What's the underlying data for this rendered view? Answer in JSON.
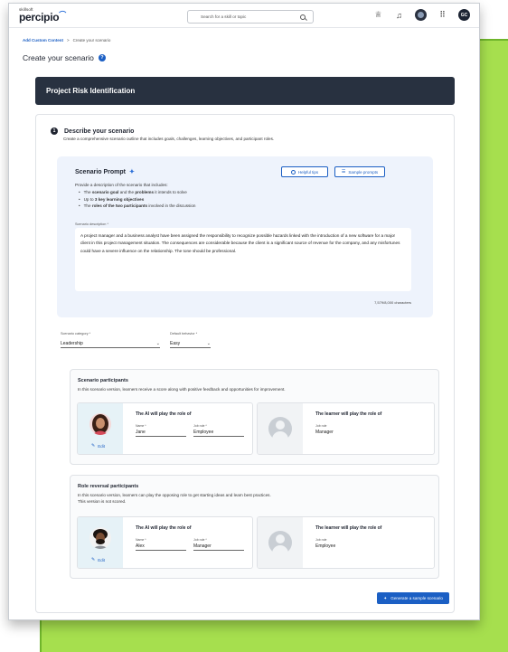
{
  "header": {
    "logo_small": "skillsoft",
    "logo_main": "percipio",
    "search_placeholder": "Search for a skill or topic",
    "avatar_initials": "GC"
  },
  "breadcrumb": {
    "root": "Add Custom Content",
    "separator": ">",
    "current": "Create your scenario"
  },
  "page_title": "Create your scenario",
  "banner_title": "Project Risk Identification",
  "step": {
    "number": "1",
    "title": "Describe your scenario",
    "description": "Create a comprehensive scenario outline that includes goals, challenges, learning objectives, and participant roles."
  },
  "prompt": {
    "title": "Scenario Prompt",
    "helpful_tips": "Helpful tips",
    "sample_prompts": "Sample prompts",
    "intro": "Provide a description of the scenario that includes:",
    "bullets": [
      {
        "pre": "The ",
        "b1": "scenario goal",
        "mid": " and the ",
        "b2": "problems",
        "post": " it intends to solve"
      },
      {
        "pre": "Up to ",
        "b1": "3 key learning objectives",
        "mid": "",
        "b2": "",
        "post": ""
      },
      {
        "pre": "The ",
        "b1": "roles of the two participants",
        "mid": "",
        "b2": "",
        "post": " involved in the discussion"
      }
    ],
    "desc_label": "Scenario description *",
    "description": "A project manager and a business analyst have been assigned the responsibility to recognize possible hazards linked with the introduction of a new software for a major client in this project management situation. The consequences are considerable because the client is a significant source of revenue for the company, and any misfortunes could have a severe influence on the relationship. The tone should be professional.",
    "char_count": "7,579/8,000 characters"
  },
  "selects": {
    "category_label": "Scenario category *",
    "category_value": "Leadership",
    "behavior_label": "Default behavior *",
    "behavior_value": "Easy"
  },
  "participants": {
    "title": "Scenario participants",
    "description": "In this scenario version, learners receive a score along with positive feedback and opportunities for improvement.",
    "ai_heading": "The AI will play the role of",
    "name_label": "Name *",
    "name_value": "Jane",
    "job_label": "Job role *",
    "job_value": "Employee",
    "edit": "Edit",
    "learner_heading": "The learner will play the role of",
    "learner_job_label": "Job role",
    "learner_job_value": "Manager"
  },
  "reversal": {
    "title": "Role reversal participants",
    "description": "In this scenario version, learners can play the opposing role to get starting ideas and learn best practices.",
    "description2": "This version is not scored.",
    "ai_heading": "The AI will play the role of",
    "name_label": "Name *",
    "name_value": "Alex",
    "job_label": "Job role *",
    "job_value": "Manager",
    "edit": "Edit",
    "learner_heading": "The learner will play the role of",
    "learner_job_label": "Job role",
    "learner_job_value": "Employee"
  },
  "generate_button": "Generate a sample scenario"
}
